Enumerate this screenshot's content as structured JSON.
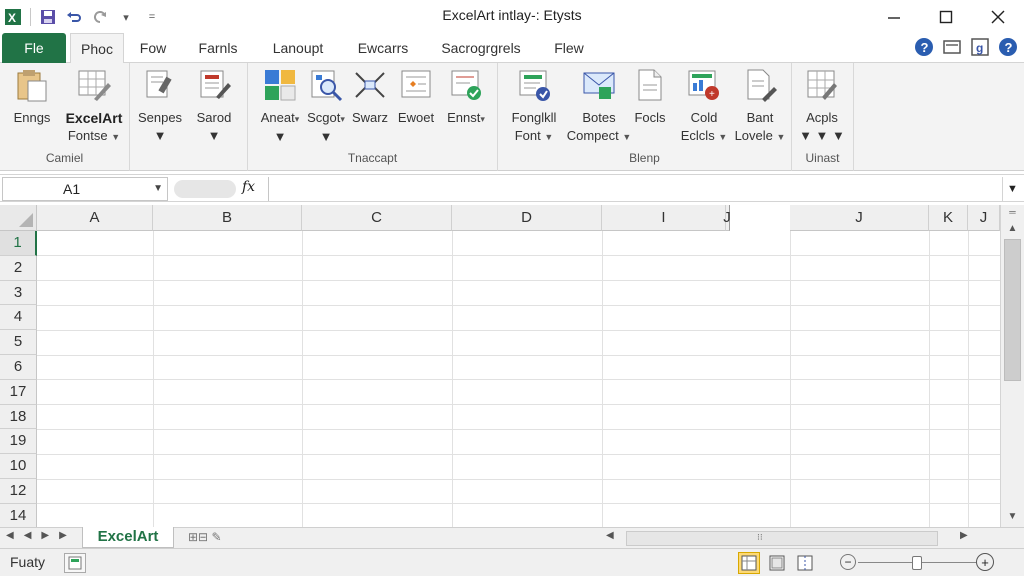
{
  "window": {
    "title": "ExcelArt intlay-: Etysts",
    "qat_extra": "="
  },
  "tabs": [
    {
      "label": "Fle"
    },
    {
      "label": "Phoc"
    },
    {
      "label": "Fow"
    },
    {
      "label": "Farnls"
    },
    {
      "label": "Lanoupt"
    },
    {
      "label": "Ewcarrs"
    },
    {
      "label": "Sacrogrgrels"
    },
    {
      "label": "Flew"
    }
  ],
  "ribbon": {
    "group1": {
      "label": "Camiel",
      "buttons": [
        {
          "l1": "Enngs",
          "l2": "",
          "icon": "paste-icon"
        },
        {
          "l1": "ExcelArt",
          "l2": "Fontse",
          "icon": "grid-pencil-icon"
        }
      ]
    },
    "group2": {
      "buttons": [
        {
          "l1": "Senpes",
          "l2": "",
          "icon": "format-painter-icon"
        },
        {
          "l1": "Sarod",
          "l2": "",
          "icon": "edit-sheet-icon"
        }
      ]
    },
    "group3": {
      "label": "Tnaccapt",
      "buttons": [
        {
          "l1": "Aneat",
          "icon": "color-blocks-icon"
        },
        {
          "l1": "Scgot",
          "icon": "magnifier-icon"
        },
        {
          "l1": "Swarz",
          "icon": "shapes-icon"
        },
        {
          "l1": "Ewoet",
          "icon": "sparkle-doc-icon"
        },
        {
          "l1": "Ennst",
          "icon": "checkmark-doc-icon"
        }
      ]
    },
    "group4": {
      "label": "Blenp",
      "buttons": [
        {
          "l1": "Fonglkll",
          "l2": "Font",
          "icon": "chart-shield-icon"
        },
        {
          "l1": "Botes",
          "l2": "Compect",
          "icon": "envelope-icon"
        },
        {
          "l1": "Focls",
          "l2": "",
          "icon": "document-icon"
        },
        {
          "l1": "Cold",
          "l2": "Eclcls",
          "icon": "chart-red-icon"
        },
        {
          "l1": "Bant",
          "l2": "Lovele",
          "icon": "doc-pen-icon"
        }
      ]
    },
    "group5": {
      "label": "Uinast",
      "buttons": [
        {
          "l1": "Acpls",
          "icon": "grid-edit-icon"
        }
      ]
    }
  },
  "formula_bar": {
    "name_box": "A1",
    "fx_label": "fx",
    "value": ""
  },
  "grid": {
    "columns": [
      "A",
      "B",
      "C",
      "D",
      "I",
      "J",
      "J",
      "K",
      "J"
    ],
    "rows": [
      "1",
      "2",
      "3",
      "4",
      "5",
      "6",
      "17",
      "18",
      "19",
      "10",
      "12",
      "14"
    ],
    "selected_row": "1"
  },
  "sheet_tabs": {
    "active": "ExcelArt",
    "extra": "⊞⊟ ✎",
    "scroll_grip": "⁝⁝"
  },
  "status": {
    "text": "Fuaty"
  },
  "colors": {
    "brand": "#217346",
    "selected_view": "#fdd975"
  }
}
